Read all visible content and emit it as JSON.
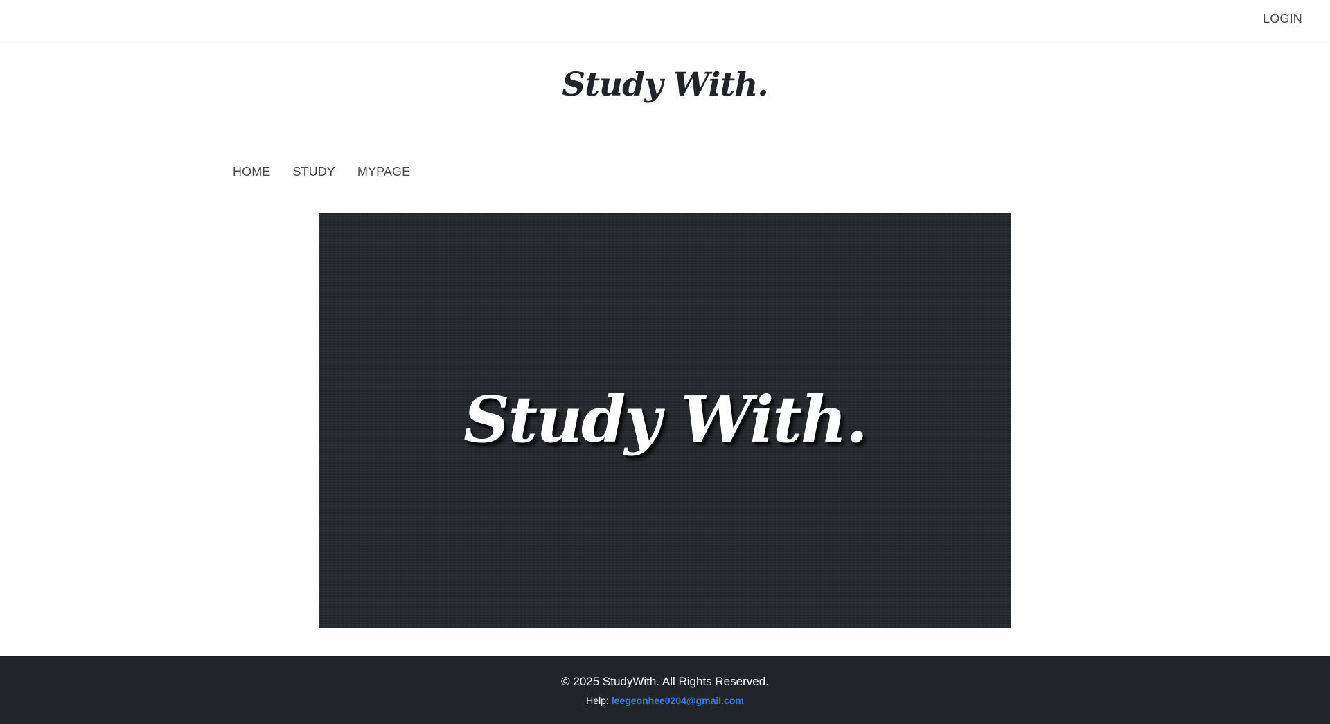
{
  "header": {
    "login_label": "LOGIN"
  },
  "brand": {
    "title": "Study With."
  },
  "nav": {
    "items": [
      {
        "label": "HOME"
      },
      {
        "label": "STUDY"
      },
      {
        "label": "MYPAGE"
      }
    ]
  },
  "hero": {
    "logo_text": "Study With.",
    "background_color": "#24272b"
  },
  "footer": {
    "copyright": "© 2025 StudyWith. All Rights Reserved.",
    "help_label": "Help:",
    "help_email": "leegeonhee0204@gmail.com",
    "background_color": "#212529",
    "link_color": "#2f7cf6"
  }
}
